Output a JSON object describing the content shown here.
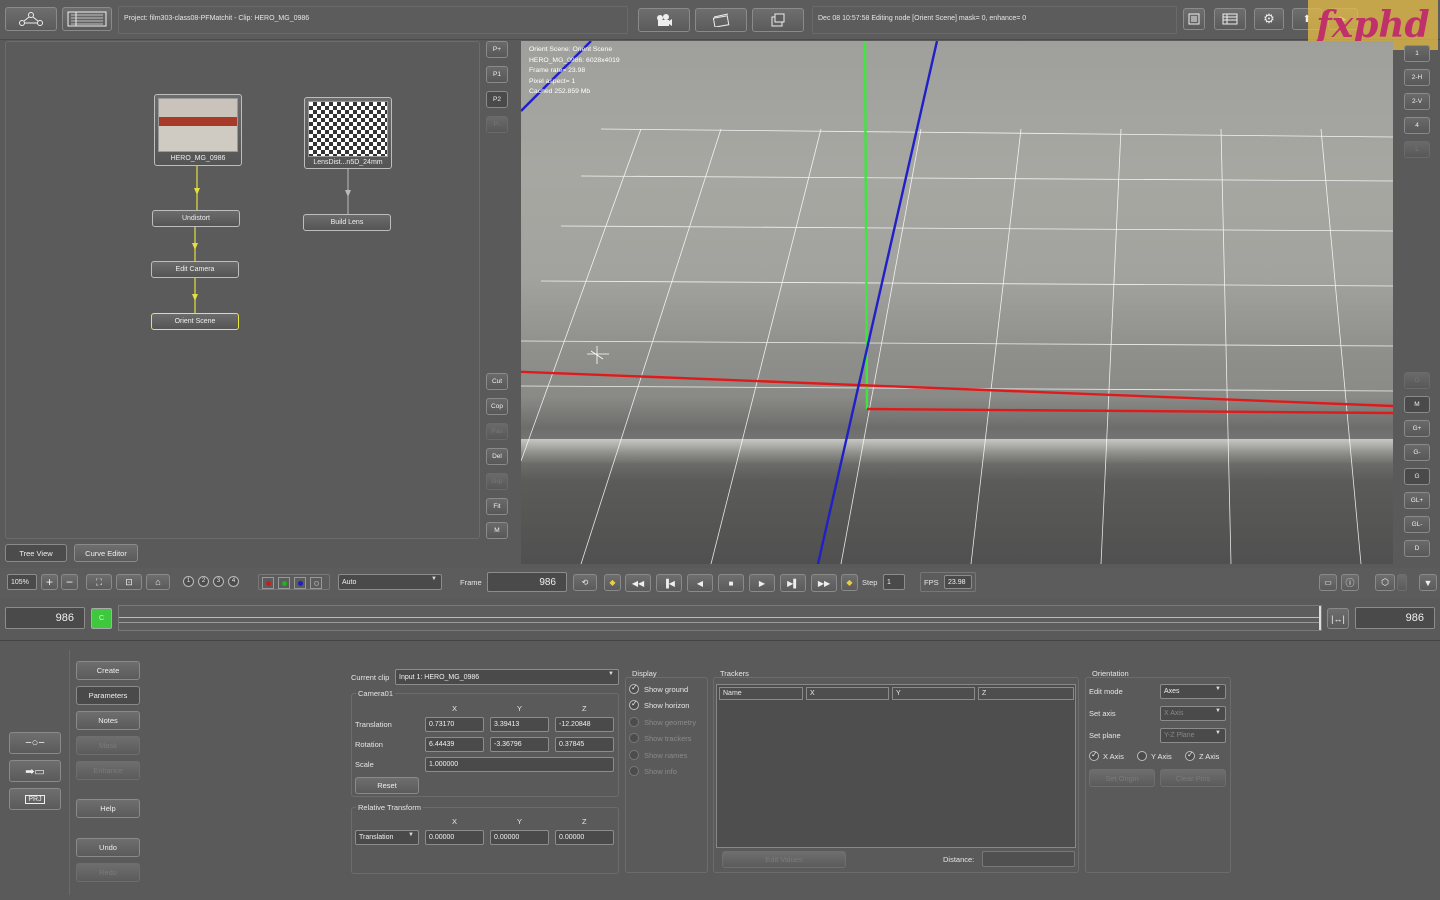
{
  "topbar": {
    "project_title": "Project: film303-class08-PFMatchit - Clip: HERO_MG_0986",
    "status": "Dec 08 10:57:58 Editing node [Orient Scene] mask= 0, enhance= 0",
    "logo_text": "fxphd"
  },
  "tree": {
    "nodes": {
      "clip": "HERO_MG_0986",
      "lens": "LensDist...n5D_24mm",
      "build_lens": "Build Lens",
      "undistort": "Undistort",
      "edit_camera": "Edit Camera",
      "orient_scene": "Orient Scene"
    },
    "tabs": {
      "tree_view": "Tree View",
      "curve_editor": "Curve Editor"
    }
  },
  "side_buttons": {
    "p_plus": "P+",
    "p1": "P1",
    "p2": "P2",
    "p_minus": "P-",
    "cut": "Cut",
    "copy": "Cop",
    "paste": "Pas",
    "delete": "Del",
    "group": "Grp",
    "fit": "Fit",
    "m": "M"
  },
  "right_buttons": [
    "1",
    "2-H",
    "2-V",
    "4",
    "L",
    "O",
    "M",
    "G+",
    "G-",
    "G",
    "GL+",
    "GL-",
    "D"
  ],
  "viewer": {
    "info": [
      "Orient Scene: Orient Scene",
      "HERO_MG_0986: 6028x4019",
      "Frame rate= 23.98",
      "Pixel aspect= 1",
      "Cached 252.859 Mb"
    ],
    "colors": {
      "y_axis": "#3ee63e",
      "x_axis": "#e01a1a",
      "z_axis": "#2020c8",
      "grid": "#ffffff"
    }
  },
  "transport": {
    "zoom": "105%",
    "views": [
      "1",
      "2",
      "3",
      "4"
    ],
    "channel": "Auto",
    "frame_label": "Frame",
    "frame": "986",
    "step_label": "Step",
    "step": "1",
    "fps_label": "FPS",
    "fps": "23.98"
  },
  "timeline": {
    "start": "986",
    "end": "986",
    "marker": "C"
  },
  "left_tools": {
    "create": "Create",
    "parameters": "Parameters",
    "notes": "Notes",
    "mask": "Mask",
    "enhance": "Enhance",
    "help": "Help",
    "undo": "Undo",
    "redo": "Redo",
    "prj": "PRJ"
  },
  "camera": {
    "current_clip_label": "Current clip",
    "current_clip": "Input 1: HERO_MG_0986",
    "group_label": "Camera01",
    "headers": [
      "X",
      "Y",
      "Z"
    ],
    "translation_label": "Translation",
    "translation": [
      "0.73170",
      "3.39413",
      "-12.20848"
    ],
    "rotation_label": "Rotation",
    "rotation": [
      "6.44439",
      "-3.36796",
      "0.37845"
    ],
    "scale_label": "Scale",
    "scale": "1.000000",
    "reset": "Reset",
    "relative_label": "Relative Transform",
    "relative_mode": "Translation",
    "relative": [
      "0.00000",
      "0.00000",
      "0.00000"
    ]
  },
  "display": {
    "label": "Display",
    "items": [
      {
        "label": "Show ground",
        "checked": true,
        "enabled": true
      },
      {
        "label": "Show horizon",
        "checked": true,
        "enabled": true
      },
      {
        "label": "Show geometry",
        "checked": false,
        "enabled": false
      },
      {
        "label": "Show trackers",
        "checked": false,
        "enabled": false
      },
      {
        "label": "Show names",
        "checked": false,
        "enabled": false
      },
      {
        "label": "Show info",
        "checked": false,
        "enabled": false
      }
    ]
  },
  "trackers": {
    "label": "Trackers",
    "columns": [
      "Name",
      "X",
      "Y",
      "Z"
    ],
    "distance_label": "Distance:",
    "edit_values": "Edit Values"
  },
  "orientation": {
    "label": "Orientation",
    "edit_mode_label": "Edit mode",
    "edit_mode": "Axes",
    "set_axis_label": "Set axis",
    "set_axis": "X Axis",
    "set_plane_label": "Set plane",
    "set_plane": "Y-Z Plane",
    "x_axis": "X Axis",
    "y_axis": "Y Axis",
    "z_axis": "Z Axis",
    "set_origin": "Set Origin",
    "clear_pins": "Clear Pins"
  }
}
